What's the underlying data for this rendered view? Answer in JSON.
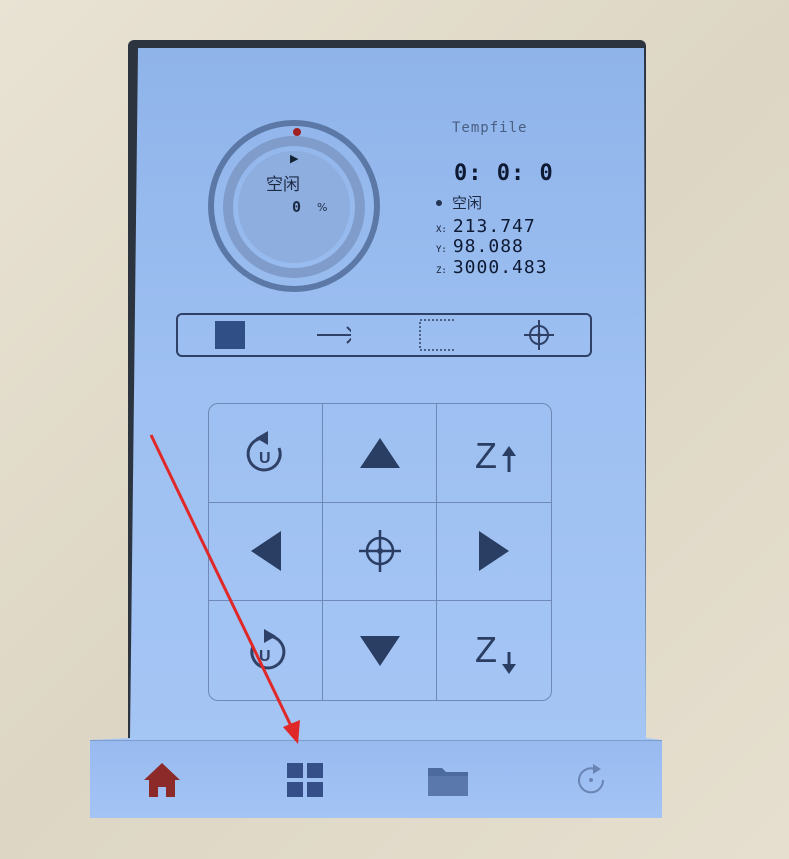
{
  "status": {
    "file_name": "Tempfile",
    "elapsed_time": "0: 0: 0",
    "state_label": "空闲",
    "progress_percent": "0",
    "percent_unit": "%"
  },
  "dial": {
    "state_label": "空闲",
    "play_icon": "▶"
  },
  "coordinates": {
    "x_label": "X:",
    "x_value": "213.747",
    "y_label": "Y:",
    "y_value": "98.088",
    "z_label": "Z:",
    "z_value": "3000.483"
  },
  "toolbar": [
    {
      "name": "filled-square-tool",
      "icon": "filled-square-icon"
    },
    {
      "name": "laser-tool",
      "icon": "laser-beam-icon"
    },
    {
      "name": "frame-tool",
      "icon": "dotted-square-icon"
    },
    {
      "name": "origin-tool",
      "icon": "crosshair-icon"
    }
  ],
  "jog_pad": [
    {
      "name": "reset-u-button",
      "icon": "rotate-u-icon"
    },
    {
      "name": "jog-up-button",
      "icon": "triangle-up-icon"
    },
    {
      "name": "z-up-button",
      "icon": "z-up-icon",
      "label": "Z"
    },
    {
      "name": "jog-left-button",
      "icon": "triangle-left-icon"
    },
    {
      "name": "jog-home-button",
      "icon": "crosshair-icon"
    },
    {
      "name": "jog-right-button",
      "icon": "triangle-right-icon"
    },
    {
      "name": "rotate-u-button",
      "icon": "rotate-u-cw-icon"
    },
    {
      "name": "jog-down-button",
      "icon": "triangle-down-icon"
    },
    {
      "name": "z-down-button",
      "icon": "z-down-icon",
      "label": "Z"
    }
  ],
  "navbar": [
    {
      "name": "nav-home",
      "icon": "home-icon",
      "active": true
    },
    {
      "name": "nav-menu",
      "icon": "grid-icon"
    },
    {
      "name": "nav-files",
      "icon": "folder-icon"
    },
    {
      "name": "nav-refresh",
      "icon": "refresh-icon"
    }
  ],
  "colors": {
    "screen_bg": "#9ec0f2",
    "home_active": "#a02020",
    "icon_dark": "#2f4166",
    "annotation_arrow": "#e02828"
  }
}
